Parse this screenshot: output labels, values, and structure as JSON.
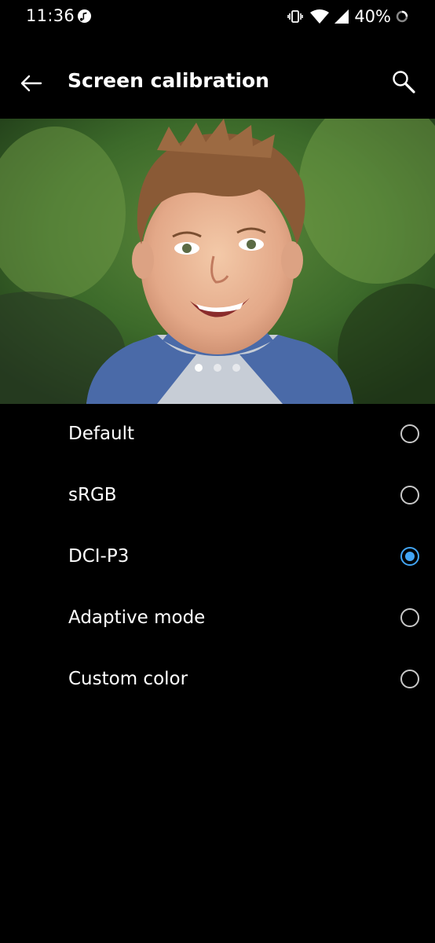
{
  "status_bar": {
    "time": "11:36",
    "battery_percent": "40%",
    "app_icon": "music-note-icon",
    "icons": [
      "vibrate-icon",
      "wifi-icon",
      "signal-icon",
      "battery-icon"
    ]
  },
  "toolbar": {
    "title": "Screen calibration",
    "back_icon": "back-arrow-icon",
    "search_icon": "search-icon"
  },
  "preview": {
    "page_count": 3,
    "current_page": 1
  },
  "options": [
    {
      "label": "Default",
      "selected": false
    },
    {
      "label": "sRGB",
      "selected": false
    },
    {
      "label": "DCI-P3",
      "selected": true
    },
    {
      "label": "Adaptive mode",
      "selected": false
    },
    {
      "label": "Custom color",
      "selected": false
    }
  ],
  "colors": {
    "background": "#000000",
    "accent": "#42a5f5",
    "text": "#ffffff"
  }
}
